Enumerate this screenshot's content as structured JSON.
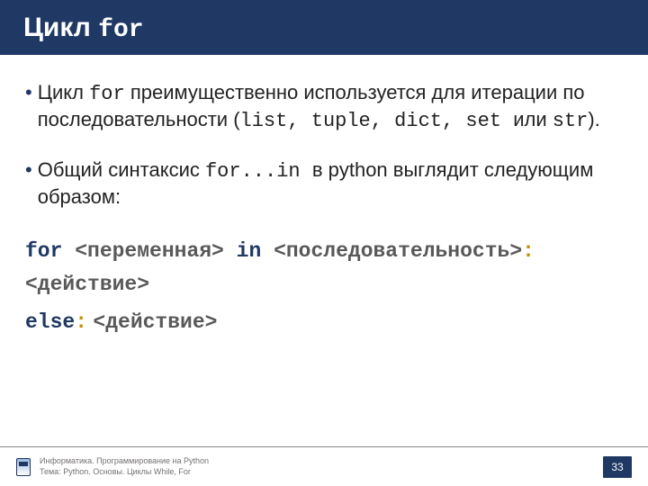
{
  "title": {
    "text": "Цикл ",
    "kw": "for"
  },
  "bullets": [
    {
      "parts": [
        {
          "t": "Цикл ",
          "c": ""
        },
        {
          "t": "for",
          "c": "mono"
        },
        {
          "t": " преимущественно используется для итерации по последовательности (",
          "c": ""
        },
        {
          "t": "list, tuple, dict, set ",
          "c": "mono"
        },
        {
          "t": "или ",
          "c": ""
        },
        {
          "t": "str",
          "c": "mono"
        },
        {
          "t": ").",
          "c": ""
        }
      ]
    },
    {
      "parts": [
        {
          "t": "Общий синтаксис ",
          "c": ""
        },
        {
          "t": "for...in ",
          "c": "mono"
        },
        {
          "t": " в python выглядит следующим образом:",
          "c": ""
        }
      ]
    }
  ],
  "syntax": {
    "line1": [
      {
        "t": "for ",
        "c": "kw-dark"
      },
      {
        "t": "<переменная>",
        "c": "angle"
      },
      {
        "t": " in ",
        "c": "kw-dark"
      },
      {
        "t": "<последовательность>",
        "c": "angle"
      },
      {
        "t": ":",
        "c": "colon"
      },
      {
        "t": "   ",
        "c": ""
      },
      {
        "t": "<действие>",
        "c": "angle"
      }
    ],
    "line2": [
      {
        "t": "else",
        "c": "kw-dark"
      },
      {
        "t": ":",
        "c": "colon"
      },
      {
        "t": " ",
        "c": ""
      },
      {
        "t": "<действие>",
        "c": "angle"
      }
    ]
  },
  "footer": {
    "line1": "Информатика. Программирование на Python",
    "line2": "Тема: Python. Основы. Циклы While, For",
    "page": "33"
  }
}
